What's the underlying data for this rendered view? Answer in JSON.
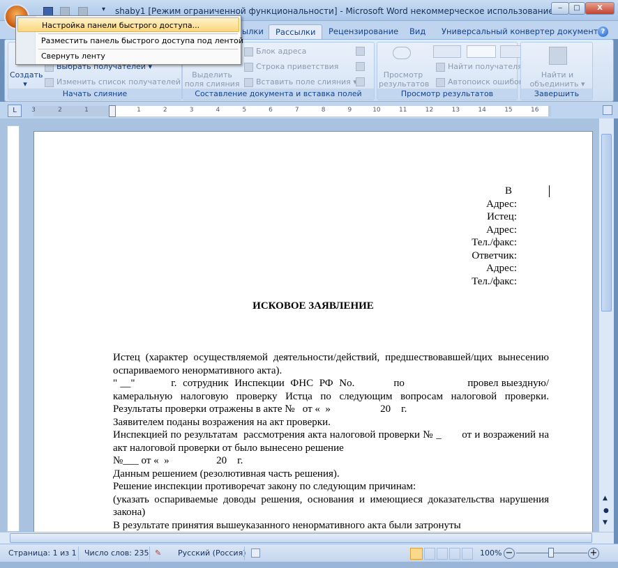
{
  "window": {
    "title": "shaby1 [Режим ограниченной функциональности] - Microsoft Word некоммерческое использование",
    "minimize": "‒",
    "maximize": "□",
    "close": "X"
  },
  "tabs": [
    {
      "label": "ылки"
    },
    {
      "label": "Рассылки",
      "active": true
    },
    {
      "label": "Рецензирование"
    },
    {
      "label": "Вид"
    },
    {
      "label": "Универсальный конвертер документов"
    }
  ],
  "help_icon": "?",
  "ribbon": {
    "groups": [
      {
        "label": "Начать слияние",
        "create": "Создать",
        "items": [
          "Выбрать получателей",
          "Изменить список получателей"
        ]
      },
      {
        "label": "Составление документа и вставка полей",
        "big": "Выделить поля слияния",
        "items": [
          "Блок адреса",
          "Строка приветствия",
          "Вставить поле слияния"
        ]
      },
      {
        "label": "Просмотр результатов",
        "big": "Просмотр результатов",
        "items": [
          "Найти получателя",
          "Автопоиск ошибок"
        ]
      },
      {
        "label": "Завершить",
        "big": "Найти и объединить"
      }
    ]
  },
  "qat_menu": {
    "items": [
      "Настройка панели быстрого доступа...",
      "Разместить панель быстрого доступа под лентой",
      "Свернуть ленту"
    ],
    "highlighted": 0
  },
  "ruler": {
    "left": [
      "3",
      "2",
      "1"
    ],
    "right": [
      "1",
      "2",
      "3",
      "4",
      "5",
      "6",
      "7",
      "8",
      "9",
      "10",
      "11",
      "12",
      "13",
      "14",
      "15",
      "16"
    ],
    "tab_selector": "L"
  },
  "document": {
    "header_lines": [
      "В",
      "Адрес:",
      "Истец:",
      "Адрес:",
      "Тел./факс:",
      "Ответчик:",
      "Адрес:",
      "Тел./факс:"
    ],
    "title": "ИСКОВОЕ ЗАЯВЛЕНИЕ",
    "paragraphs": [
      "Истец (характер осуществляемой деятельности/действий, предшествовавшей/щих вынесению оспариваемого ненормативного акта).",
      "\" __\"            г.  сотрудник  Инспекции  ФНС  РФ  No.             по                     провел выездную/камеральную налоговую проверку Истца по следующим вопросам налоговой проверки.  Результаты проверки отражены в акте №   от «  »                   20    г.",
      "Заявителем поданы возражения на акт проверки.",
      "Инспекцией по результатам  рассмотрения акта налоговой проверки № _       от и возражений на акт налоговой проверки от было вынесено решение",
      "№___ от «  »                  20    г.",
      "Данным решением (резолютивная часть решения).",
      "Решение инспекции противоречат  закону по следующим причинам:",
      "(указать  оспариваемые доводы решения, основания и имеющиеся доказательства нарушения закона)",
      "В результате принятия вышеуказанного ненормативного акта были затронуты"
    ]
  },
  "status": {
    "page": "Страница: 1 из 1",
    "words": "Число слов: 235",
    "language": "Русский (Россия)",
    "zoom": "100%",
    "zoom_percent": 100
  }
}
